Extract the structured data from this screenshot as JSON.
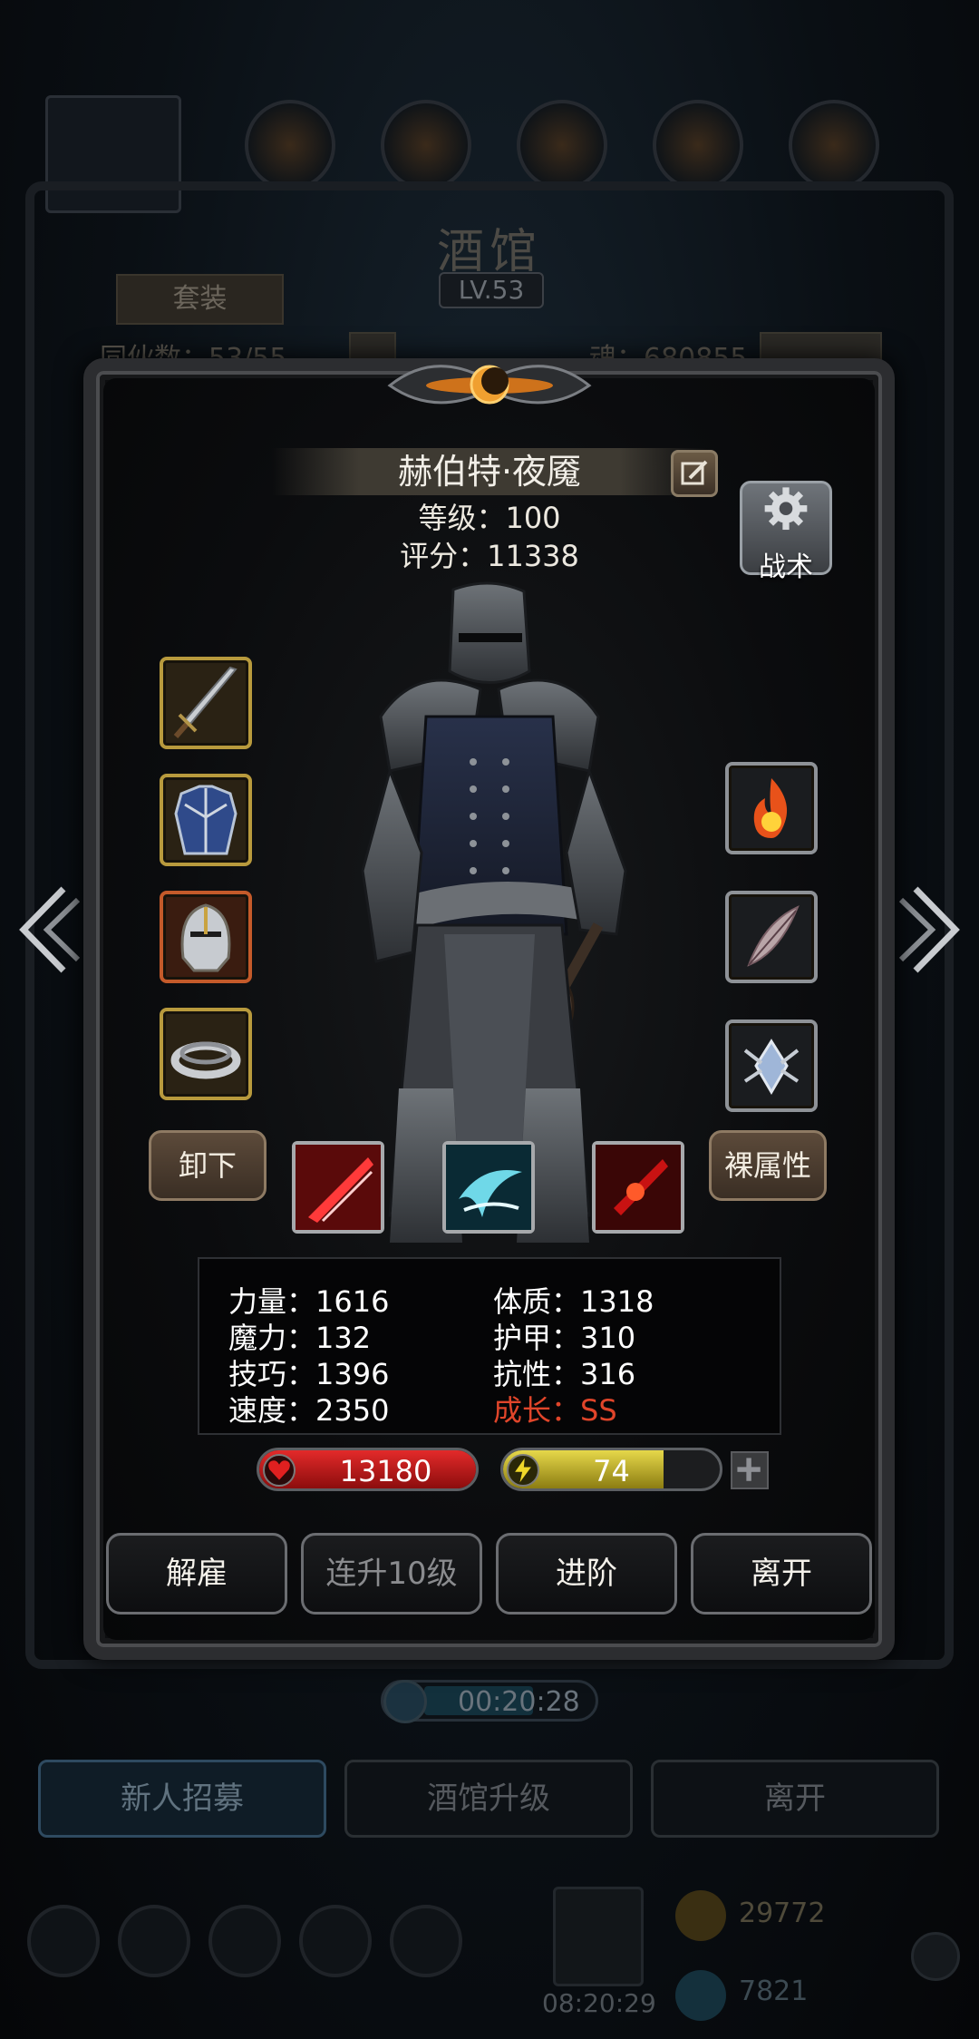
{
  "background": {
    "title": "酒馆",
    "level_badge": "LV.53",
    "set_button": "套装",
    "left_stat": "同伙数：53/55",
    "right_stat": "魂：680855",
    "timer": "00:20:28",
    "bottom_buttons": [
      "新人招募",
      "酒馆升级",
      "离开"
    ],
    "dock_timer": "08:20:29",
    "gold": "29772",
    "gems": "7821"
  },
  "hero": {
    "name": "赫伯特·夜魇",
    "level_text": "等级：100",
    "score_text": "评分：11338"
  },
  "tactics_label": "战术",
  "buttons": {
    "unequip": "卸下",
    "bare_attributes": "裸属性"
  },
  "equipment_left": [
    "sword-icon",
    "chest-armor-icon",
    "helmet-icon",
    "ring-icon"
  ],
  "equipment_right": [
    "fire-orb-icon",
    "feather-icon",
    "crystal-emblem-icon"
  ],
  "skills": [
    "red-slash-icon",
    "ice-swirl-icon",
    "blood-strike-icon"
  ],
  "stats": {
    "left": [
      "力量：1616",
      "魔力：132",
      "技巧：1396",
      "速度：2350"
    ],
    "right": [
      "体质：1318",
      "护甲：310",
      "抗性：316",
      "成长：SS"
    ]
  },
  "bars": {
    "hp_value": "13180",
    "hp_fill": 1.0,
    "energy_value": "74",
    "energy_fill": 0.74
  },
  "actions": [
    "解雇",
    "连升10级",
    "进阶",
    "离开"
  ],
  "colors": {
    "growth": "#e0452a",
    "hp": "#e32a2a",
    "energy": "#e6d84a",
    "gold_border": "#b89a3d"
  }
}
